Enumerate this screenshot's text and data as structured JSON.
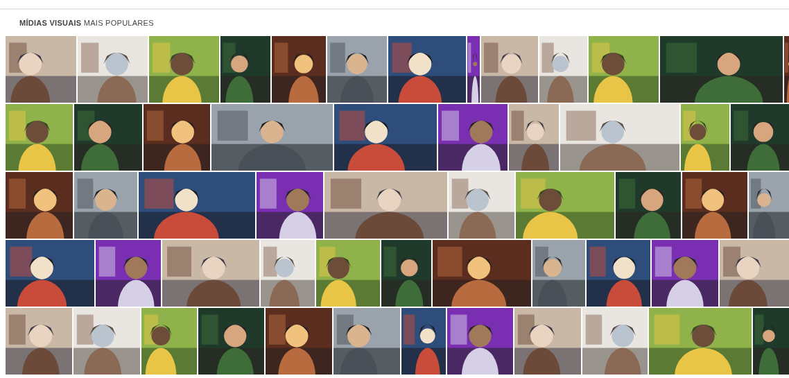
{
  "section": {
    "title": "**MÍDIAS VISUAIS** MAIS POPULARES"
  }
}
